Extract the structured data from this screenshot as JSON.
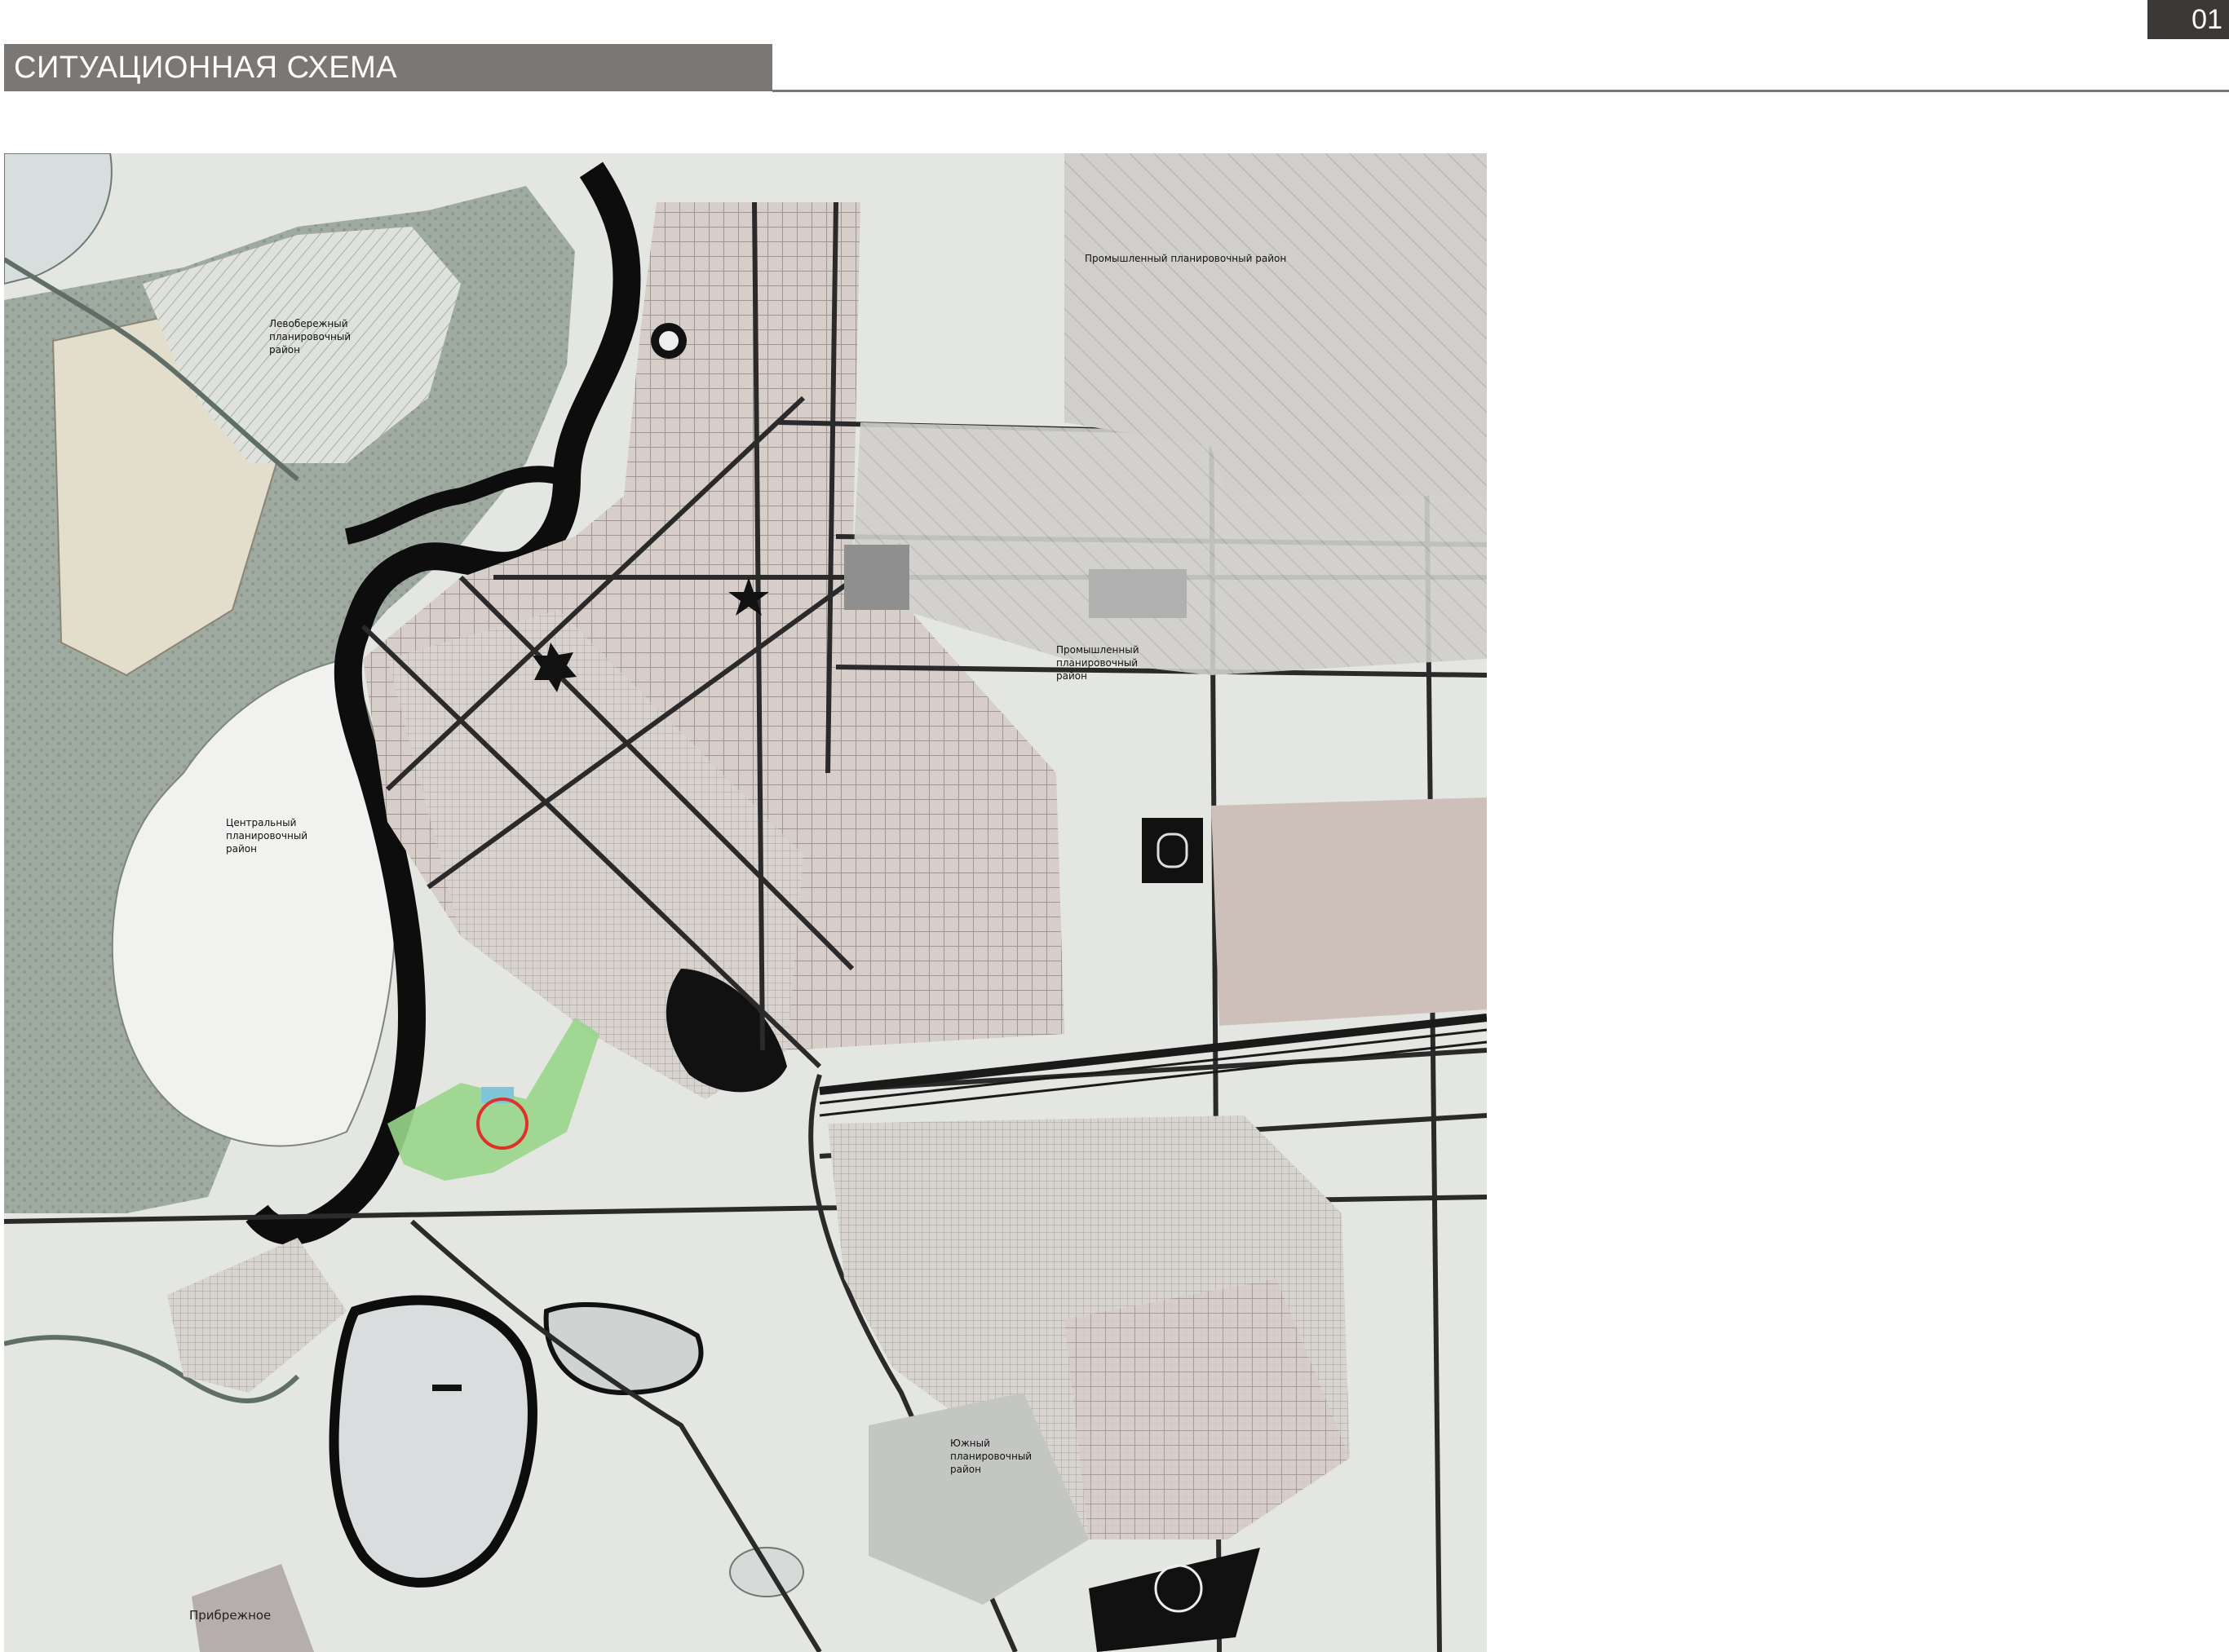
{
  "header": {
    "title": "СИТУАЦИОННАЯ СХЕМА",
    "page_number": "01"
  },
  "map": {
    "districts": [
      {
        "id": "left-bank",
        "lines": [
          "Левобережный",
          "планировочный",
          "район"
        ]
      },
      {
        "id": "central",
        "lines": [
          "Центральный",
          "планировочный",
          "район"
        ]
      },
      {
        "id": "industrial-north",
        "lines": [
          "Промышленный планировочный район"
        ]
      },
      {
        "id": "industrial-east",
        "lines": [
          "Промышленный",
          "планировочный",
          "район"
        ]
      },
      {
        "id": "south",
        "lines": [
          "Южный",
          "планировочный",
          "район"
        ]
      }
    ],
    "settlements": [
      {
        "id": "pribrezhnoe",
        "label": "Прибрежное"
      }
    ],
    "highlight_marker": {
      "shape": "circle",
      "color": "#e0302a"
    },
    "colors": {
      "water": "#d7dcdc",
      "river_dark": "#0b0b0b",
      "urban_block": "#cbc2c2",
      "residential": "#d9d2c8",
      "forest": "#8d9a8e",
      "field": "#e6e8e2",
      "industrial": "#c9c9c9",
      "road": "#2a2a2a",
      "project_site": "#8fd07c"
    }
  }
}
